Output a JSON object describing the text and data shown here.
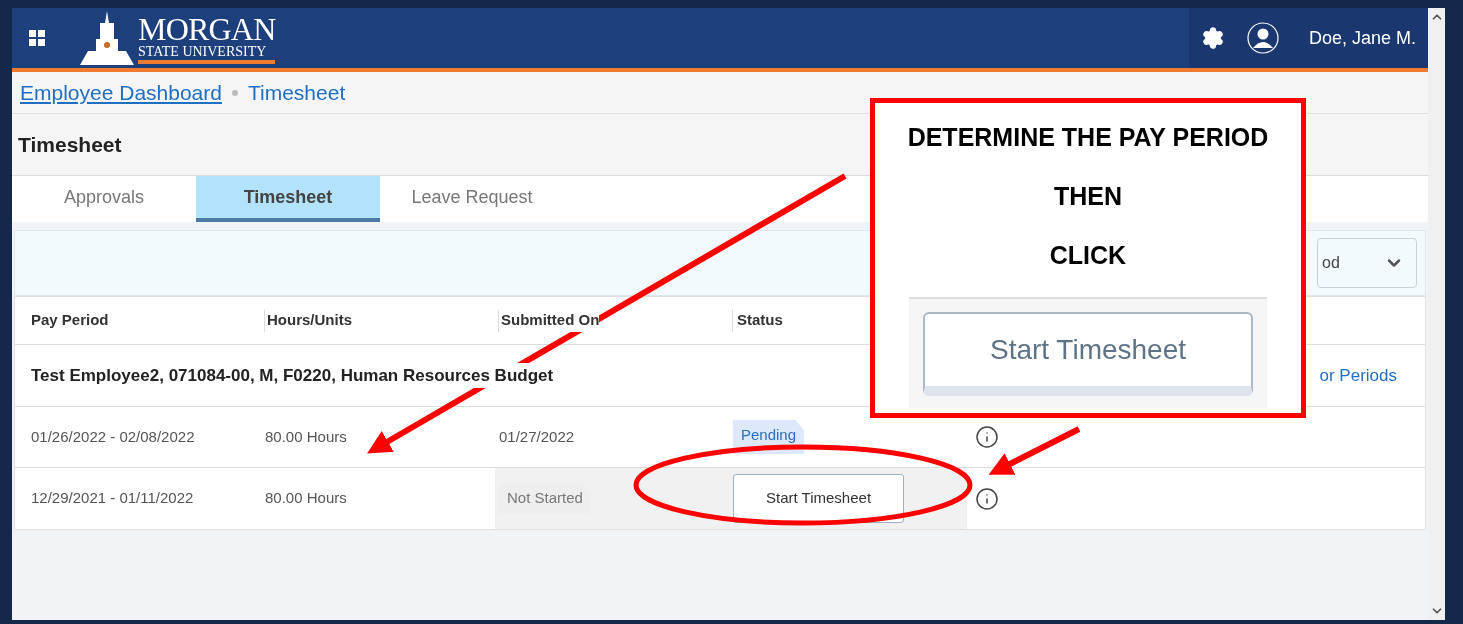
{
  "header": {
    "logo_top": "MORGAN",
    "logo_bottom": "STATE UNIVERSITY",
    "user": "Doe, Jane M."
  },
  "breadcrumb": [
    {
      "label": "Employee Dashboard",
      "kind": "link"
    },
    {
      "label": "Timesheet",
      "kind": "current"
    }
  ],
  "page_title": "Timesheet",
  "tabs": [
    {
      "label": "Approvals",
      "selected": false
    },
    {
      "label": "Timesheet",
      "selected": true
    },
    {
      "label": "Leave Request",
      "selected": false
    }
  ],
  "filter": {
    "dropdown_value": "od"
  },
  "table": {
    "columns": [
      "Pay Period",
      "Hours/Units",
      "Submitted On",
      "Status"
    ],
    "group": {
      "label": "Test Employee2, 071084-00, M, F0220, Human Resources Budget",
      "link": "or Periods"
    },
    "rows": [
      {
        "pay_period": "01/26/2022 - 02/08/2022",
        "hours": "80.00 Hours",
        "submitted": {
          "kind": "text",
          "text": "01/27/2022"
        },
        "status": {
          "kind": "badge",
          "text": "Pending"
        },
        "highlighted": false
      },
      {
        "pay_period": "12/29/2021 - 01/11/2022",
        "hours": "80.00 Hours",
        "submitted": {
          "kind": "tag",
          "text": "Not Started"
        },
        "status": {
          "kind": "button",
          "text": "Start Timesheet"
        },
        "highlighted": true
      }
    ]
  },
  "callout": {
    "lines": [
      "DETERMINE THE PAY PERIOD",
      "THEN",
      "CLICK"
    ],
    "button_label": "Start Timesheet"
  }
}
